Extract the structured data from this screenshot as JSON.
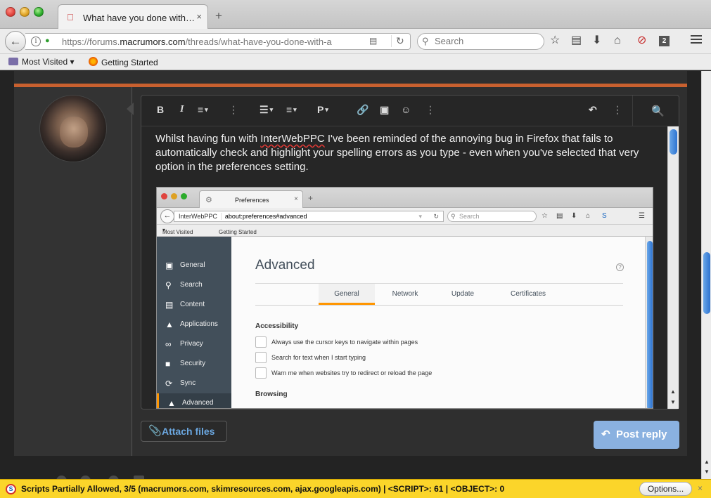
{
  "browser": {
    "tab_title": "What have you done with a Mac today?",
    "tab_close": "×",
    "new_tab": "+",
    "url_prefix": "https://forums.",
    "url_domain": "macrumors.com",
    "url_path": "/threads/what-have-you-done-with-a",
    "search_placeholder": "Search",
    "badge_count": "2",
    "bookmarks": [
      "Most Visited",
      "Getting Started"
    ]
  },
  "editor": {
    "toolbar": {
      "bold": "B",
      "italic": "I",
      "paragraph": "P"
    },
    "content": {
      "before": "Whilst having fun with ",
      "misspelled": "InterWebPPC",
      "after": " I've been reminded of the annoying bug in Firefox that fails to automatically check and highlight your spelling errors as you type - even when you've selected that very option in the preferences setting."
    }
  },
  "screenshot": {
    "tab_title": "Preferences",
    "url_label": "InterWebPPC",
    "url": "about:preferences#advanced",
    "search_placeholder": "Search",
    "bookmarks": [
      "Most Visited",
      "Getting Started"
    ],
    "sidebar": [
      {
        "label": "General",
        "icon": "general-icon"
      },
      {
        "label": "Search",
        "icon": "search-icon"
      },
      {
        "label": "Content",
        "icon": "content-icon"
      },
      {
        "label": "Applications",
        "icon": "applications-icon"
      },
      {
        "label": "Privacy",
        "icon": "privacy-mask-icon"
      },
      {
        "label": "Security",
        "icon": "lock-icon"
      },
      {
        "label": "Sync",
        "icon": "sync-icon"
      },
      {
        "label": "Advanced",
        "icon": "advanced-icon"
      }
    ],
    "active_sidebar": "Advanced",
    "page_title": "Advanced",
    "help": "?",
    "tabs": [
      "General",
      "Network",
      "Update",
      "Certificates"
    ],
    "active_tab": "General",
    "section_accessibility": "Accessibility",
    "checkboxes": [
      "Always use the cursor keys to navigate within pages",
      "Search for text when I start typing",
      "Warn me when websites try to redirect or reload the page"
    ],
    "section_browsing": "Browsing"
  },
  "actions": {
    "attach_files": "Attach files",
    "post_reply": "Post reply"
  },
  "noscript": {
    "message": "Scripts Partially Allowed, 3/5 (macrumors.com, skimresources.com, ajax.googleapis.com) | <SCRIPT>: 61 | <OBJECT>: 0",
    "options": "Options...",
    "close": "×"
  },
  "colors": {
    "accent_orange": "#c8602f",
    "link_blue": "#6ba7e0",
    "post_button": "#8ab1e0",
    "noscript_yellow": "#fbd52a"
  }
}
